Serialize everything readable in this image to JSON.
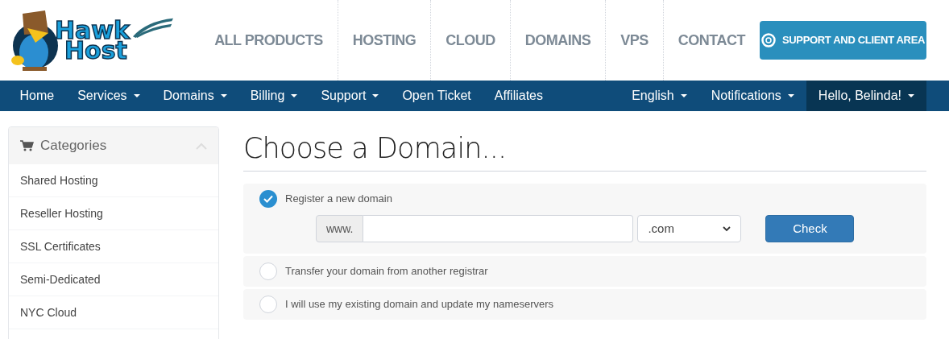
{
  "logo": {
    "line_1": "Hawk",
    "line_2": "Host"
  },
  "top_menu": [
    {
      "label": "ALL PRODUCTS"
    },
    {
      "label": "HOSTING"
    },
    {
      "label": "CLOUD"
    },
    {
      "label": "DOMAINS"
    },
    {
      "label": "VPS"
    },
    {
      "label": "CONTACT"
    }
  ],
  "support_button": "SUPPORT AND CLIENT AREA",
  "nav_left": [
    {
      "label": "Home",
      "dropdown": false
    },
    {
      "label": "Services",
      "dropdown": true
    },
    {
      "label": "Domains",
      "dropdown": true
    },
    {
      "label": "Billing",
      "dropdown": true
    },
    {
      "label": "Support",
      "dropdown": true
    },
    {
      "label": "Open Ticket",
      "dropdown": false
    },
    {
      "label": "Affiliates",
      "dropdown": false
    }
  ],
  "nav_right": [
    {
      "label": "English",
      "dropdown": true,
      "selected": false
    },
    {
      "label": "Notifications",
      "dropdown": true,
      "selected": false
    },
    {
      "label": "Hello, Belinda!",
      "dropdown": true,
      "selected": true
    }
  ],
  "sidebar": {
    "title": "Categories",
    "expanded": true,
    "items": [
      {
        "label": "Shared Hosting"
      },
      {
        "label": "Reseller Hosting"
      },
      {
        "label": "SSL Certificates"
      },
      {
        "label": "Semi-Dedicated"
      },
      {
        "label": "NYC Cloud"
      }
    ]
  },
  "page_title": "Choose a Domain...",
  "options": [
    {
      "label": "Register a new domain",
      "selected": true
    },
    {
      "label": "Transfer your domain from another registrar",
      "selected": false
    },
    {
      "label": "I will use my existing domain and update my nameservers",
      "selected": false
    }
  ],
  "domain_form": {
    "prefix": "www.",
    "tld": ".com",
    "button": "Check"
  }
}
